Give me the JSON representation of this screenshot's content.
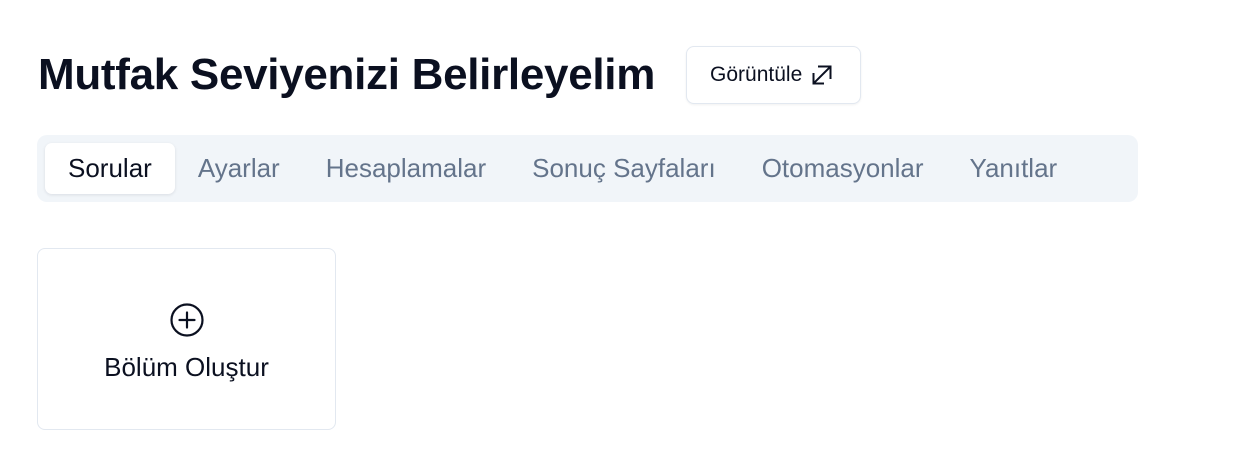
{
  "header": {
    "title": "Mutfak Seviyenizi Belirleyelim",
    "view_button": {
      "label": "Görüntüle",
      "icon": "external-link-icon"
    }
  },
  "tabs": [
    {
      "label": "Sorular",
      "active": true
    },
    {
      "label": "Ayarlar",
      "active": false
    },
    {
      "label": "Hesaplamalar",
      "active": false
    },
    {
      "label": "Sonuç Sayfaları",
      "active": false
    },
    {
      "label": "Otomasyonlar",
      "active": false
    },
    {
      "label": "Yanıtlar",
      "active": false
    }
  ],
  "create_section": {
    "label": "Bölüm Oluştur",
    "icon": "plus-circle-icon"
  },
  "colors": {
    "text": "#0b1020",
    "muted": "#64748b",
    "tab_bar_bg": "#f1f5f9",
    "border": "#e2e8f0"
  }
}
